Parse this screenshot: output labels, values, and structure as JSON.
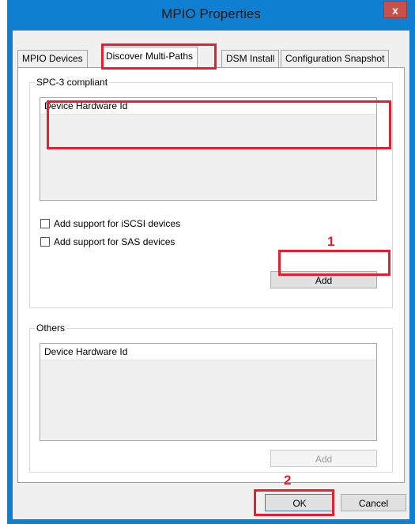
{
  "window": {
    "title": "MPIO Properties",
    "close_glyph": "x"
  },
  "tabs": [
    {
      "label": "MPIO Devices"
    },
    {
      "label": "Discover Multi-Paths"
    },
    {
      "label": "DSM Install"
    },
    {
      "label": "Configuration Snapshot"
    }
  ],
  "spc3": {
    "group_label": "SPC-3 compliant",
    "list_header": "Device Hardware Id",
    "checkbox_iscsi": "Add support for iSCSI devices",
    "checkbox_sas": "Add support for SAS devices",
    "add_label": "Add"
  },
  "others": {
    "group_label": "Others",
    "list_header": "Device Hardware Id",
    "add_label": "Add"
  },
  "footer": {
    "ok_label": "OK",
    "cancel_label": "Cancel"
  },
  "annotations": {
    "marker_1": "1",
    "marker_2": "2"
  },
  "colors": {
    "highlight": "#e3202f",
    "window_frame": "#0f7fd1"
  }
}
